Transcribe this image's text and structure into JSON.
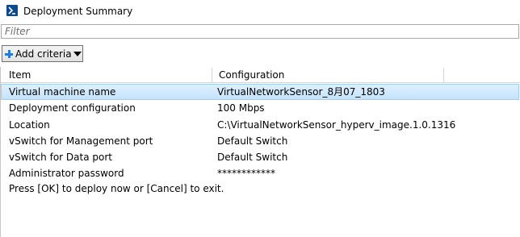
{
  "window": {
    "title": "Deployment Summary",
    "icon": "powershell-icon"
  },
  "filter": {
    "placeholder": "Filter",
    "value": ""
  },
  "toolbar": {
    "add_criteria_label": "Add criteria"
  },
  "grid": {
    "columns": [
      "Item",
      "Configuration"
    ],
    "rows": [
      {
        "item": "Virtual machine name",
        "configuration": "VirtualNetworkSensor_8月07_1803",
        "selected": true
      },
      {
        "item": "Deployment configuration",
        "configuration": "100 Mbps"
      },
      {
        "item": "Location",
        "configuration": "C:\\VirtualNetworkSensor_hyperv_image.1.0.1316"
      },
      {
        "item": "vSwitch for Management port",
        "configuration": "Default Switch"
      },
      {
        "item": "vSwitch for Data port",
        "configuration": "Default Switch"
      },
      {
        "item": "Administrator password",
        "configuration": "************"
      }
    ],
    "footer_text": "Press [OK] to deploy now or [Cancel] to exit."
  },
  "colors": {
    "selection_bg": "#cce8fb",
    "selection_border": "#9fd1f6",
    "accent": "#2a7ad0"
  }
}
